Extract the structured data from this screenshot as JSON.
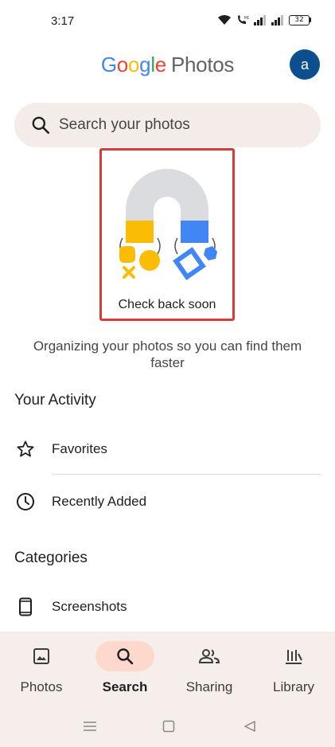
{
  "status_bar": {
    "time": "3:17",
    "battery": "32"
  },
  "header": {
    "logo_letters": [
      "G",
      "o",
      "o",
      "g",
      "l",
      "e"
    ],
    "logo_suffix": "Photos",
    "avatar_initial": "a",
    "avatar_color": "#0b4f8f"
  },
  "search": {
    "placeholder": "Search your photos"
  },
  "illustration": {
    "caption": "Check back soon",
    "colors": {
      "magnet": "#dadce0",
      "yellow": "#fbbc04",
      "blue": "#4285f4",
      "highlight_border": "#d93b3b"
    }
  },
  "organizing_text": "Organizing your photos so you can find them faster",
  "activity": {
    "title": "Your Activity",
    "items": [
      {
        "label": "Favorites",
        "icon": "star-icon"
      },
      {
        "label": "Recently Added",
        "icon": "clock-icon"
      }
    ]
  },
  "categories": {
    "title": "Categories",
    "items": [
      {
        "label": "Screenshots",
        "icon": "phone-icon"
      }
    ]
  },
  "bottom_nav": {
    "active_color": "#fcd9cc",
    "items": [
      {
        "label": "Photos",
        "icon": "photo-icon",
        "active": false
      },
      {
        "label": "Search",
        "icon": "search-icon",
        "active": true
      },
      {
        "label": "Sharing",
        "icon": "people-icon",
        "active": false
      },
      {
        "label": "Library",
        "icon": "library-icon",
        "active": false
      }
    ]
  },
  "system_nav": {
    "buttons": [
      "menu-icon",
      "home-icon",
      "back-icon"
    ]
  }
}
